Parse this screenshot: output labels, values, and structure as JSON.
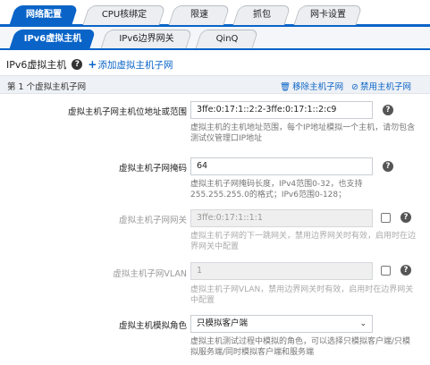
{
  "top_tabs": [
    "网络配置",
    "CPU核绑定",
    "限速",
    "抓包",
    "网卡设置"
  ],
  "sub_tabs": [
    "IPv6虚拟主机",
    "IPv6边界网关",
    "QinQ"
  ],
  "heading": {
    "title": "IPv6虚拟主机",
    "help": "?",
    "add_link": "添加虚拟主机子网",
    "add_icon": "+"
  },
  "subnet_bar": {
    "count": "第 1 个虚拟主机子网",
    "remove": "移除主机子网",
    "disable": "禁用主机子网",
    "remove_icon": "🗑",
    "disable_icon": "⊘"
  },
  "form": {
    "ip_range": {
      "label": "虚拟主机子网主机位地址或范围",
      "value": "3ffe:0:17:1::2:2-3ffe:0:17:1::2:c9",
      "hint": "虚拟主机的主机地址范围，每个IP地址模拟一个主机，请勿包含测试仪管理口IP地址"
    },
    "mask": {
      "label": "虚拟主机子网掩码",
      "value": "64",
      "hint": "虚拟主机子网掩码长度，IPv4范围0-32，也支持255.255.255.0的格式；IPv6范围0-128；"
    },
    "gateway": {
      "label": "虚拟主机子网网关",
      "value": "3ffe:0:17:1::1:1",
      "hint": "虚拟主机子网的下一跳网关，禁用边界网关时有效，启用时在边界网关中配置"
    },
    "vlan": {
      "label": "虚拟主机子网VLAN",
      "value": "1",
      "hint": "虚拟主机子网VLAN，禁用边界网关时有效，启用时在边界网关中配置"
    },
    "role": {
      "label": "虚拟主机模拟角色",
      "value": "只模拟客户端",
      "hint": "虚拟主机测试过程中模拟的角色，可以选择只模拟客户端/只模拟服务端/同时模拟客户端和服务端"
    }
  },
  "colors": {
    "accent": "#0a64c8"
  }
}
